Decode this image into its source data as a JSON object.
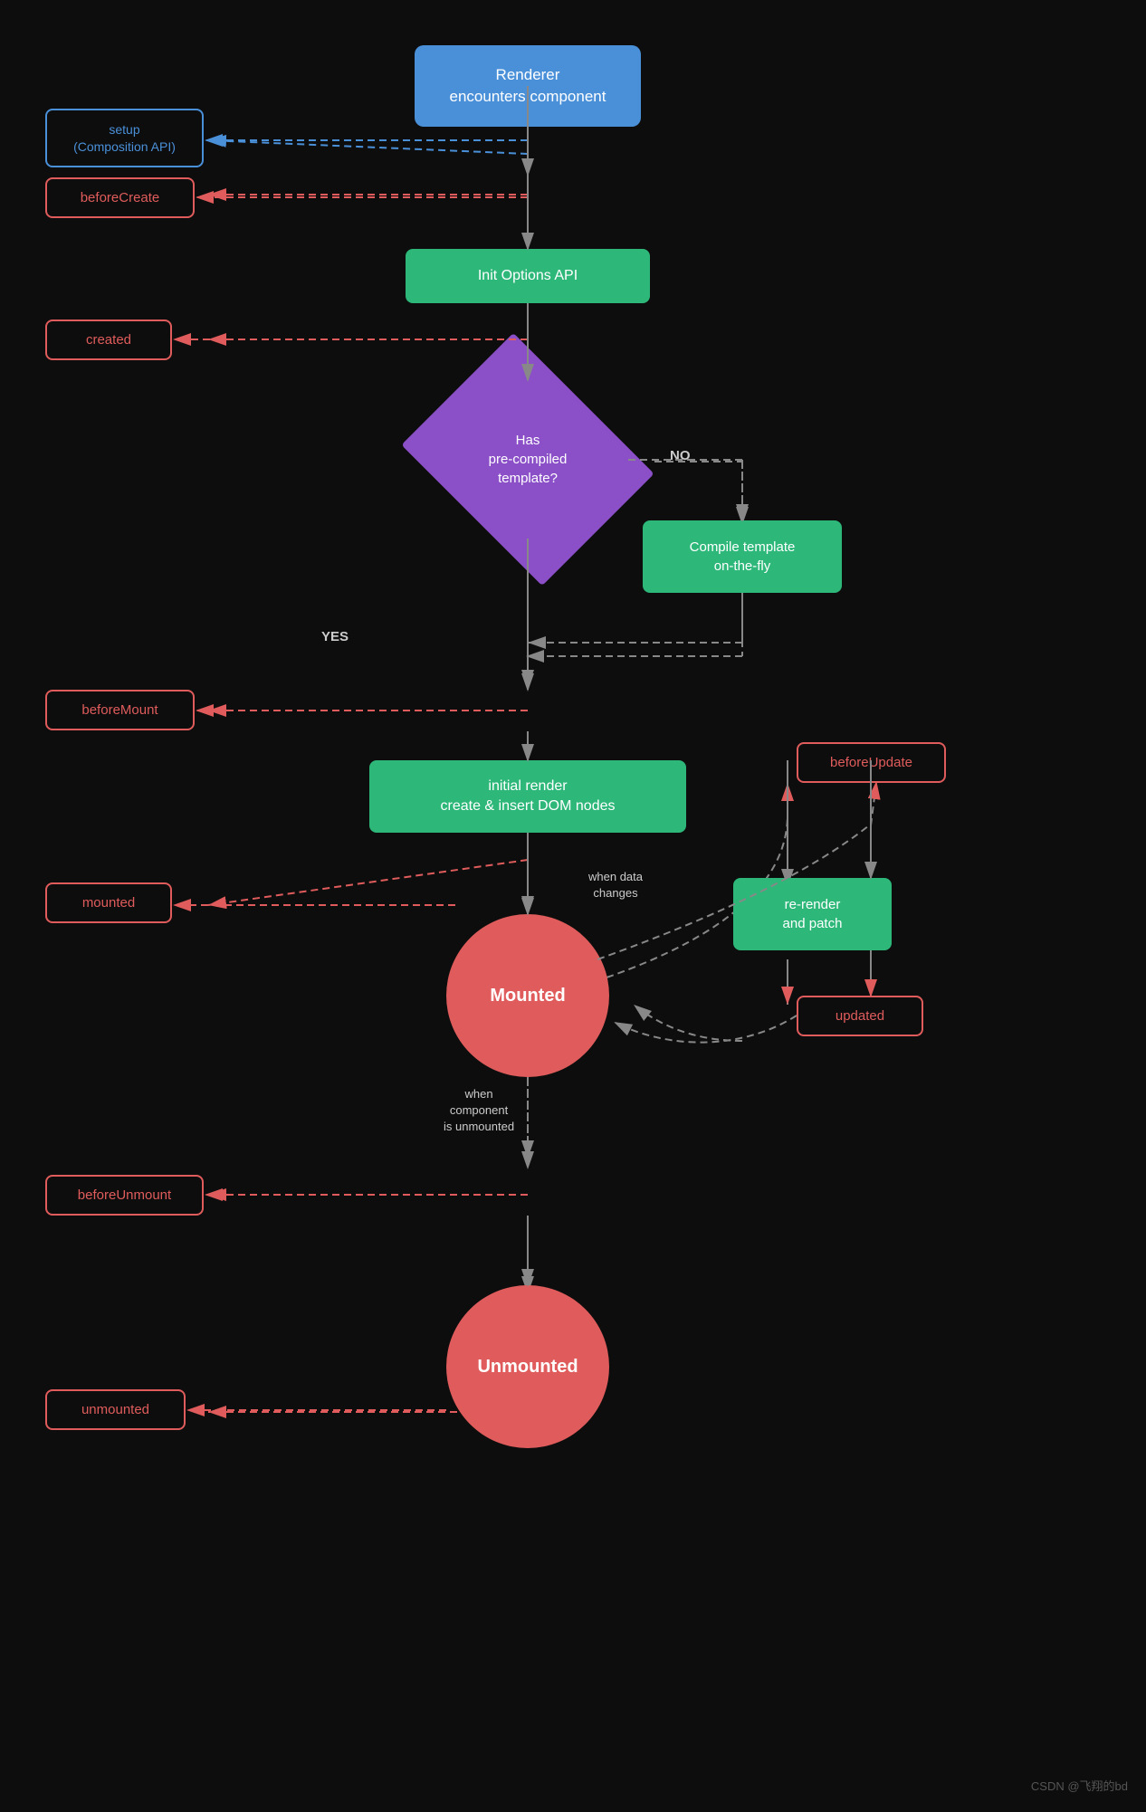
{
  "nodes": {
    "renderer": {
      "label": "Renderer\nencounters component"
    },
    "setup": {
      "label": "setup\n(Composition API)"
    },
    "beforeCreate": {
      "label": "beforeCreate"
    },
    "initOptions": {
      "label": "Init Options API"
    },
    "created": {
      "label": "created"
    },
    "hasTemplate": {
      "label": "Has\npre-compiled\ntemplate?"
    },
    "compileTemplate": {
      "label": "Compile template\non-the-fly"
    },
    "beforeMount": {
      "label": "beforeMount"
    },
    "initialRender": {
      "label": "initial render\ncreate & insert DOM nodes"
    },
    "mounted": {
      "label": "mounted"
    },
    "mountedCircle": {
      "label": "Mounted"
    },
    "rerender": {
      "label": "re-render\nand patch"
    },
    "beforeUpdate": {
      "label": "beforeUpdate"
    },
    "updated": {
      "label": "updated"
    },
    "whenDataChanges": {
      "label": "when data\nchanges"
    },
    "whenUnmounted": {
      "label": "when\ncomponent\nis unmounted"
    },
    "beforeUnmount": {
      "label": "beforeUnmount"
    },
    "unmountedCircle": {
      "label": "Unmounted"
    },
    "unmounted": {
      "label": "unmounted"
    }
  },
  "labels": {
    "no": "NO",
    "yes": "YES"
  },
  "watermark": "CSDN @飞翔的bd"
}
